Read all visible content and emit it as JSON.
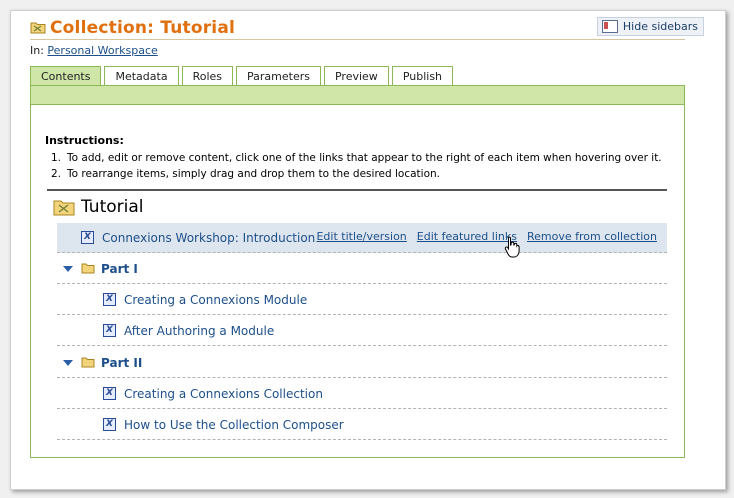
{
  "header": {
    "title": "Collection: Tutorial",
    "hide_sidebars_label": "Hide sidebars",
    "breadcrumb_prefix": "In:",
    "breadcrumb_link": "Personal Workspace"
  },
  "tabs": [
    {
      "label": "Contents",
      "active": true
    },
    {
      "label": "Metadata"
    },
    {
      "label": "Roles"
    },
    {
      "label": "Parameters"
    },
    {
      "label": "Preview"
    },
    {
      "label": "Publish"
    }
  ],
  "instructions": {
    "heading": "Instructions:",
    "items": [
      {
        "num": "1.",
        "text": "To add, edit or remove content, click one of the links that appear to the right of each item when hovering over it."
      },
      {
        "num": "2.",
        "text": "To rearrange items, simply drag and drop them to the desired location."
      }
    ]
  },
  "collection": {
    "title": "Tutorial",
    "rows": [
      {
        "type": "module",
        "label": "Connexions Workshop: Introduction"
      },
      {
        "type": "section",
        "label": "Part I"
      },
      {
        "type": "module",
        "label": "Creating a Connexions Module"
      },
      {
        "type": "module",
        "label": "After Authoring a Module"
      },
      {
        "type": "section",
        "label": "Part II"
      },
      {
        "type": "module",
        "label": "Creating a Connexions Collection"
      },
      {
        "type": "module",
        "label": "How to Use the Collection Composer"
      }
    ],
    "hover_actions": {
      "edit_title": "Edit title/version",
      "edit_links": "Edit featured links",
      "remove": "Remove from collection"
    }
  }
}
